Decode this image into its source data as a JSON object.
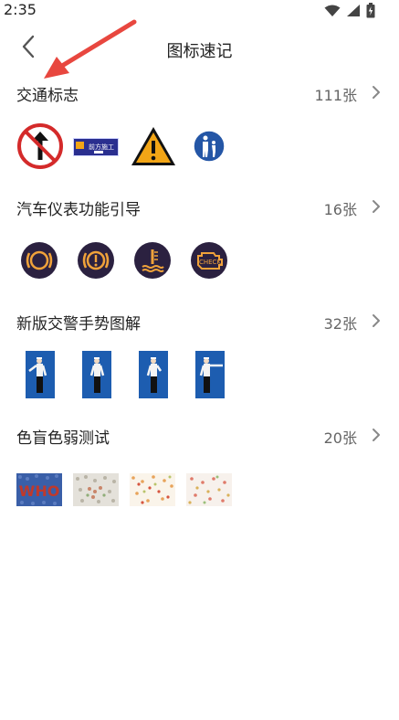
{
  "status_bar": {
    "time": "2:35",
    "icons": [
      "wifi-icon",
      "signal-icon",
      "battery-icon"
    ]
  },
  "header": {
    "title": "图标速记",
    "back_icon": "chevron-left-icon"
  },
  "sections": [
    {
      "title": "交通标志",
      "count": "111张",
      "thumbnails": [
        "no-straight-sign-icon",
        "road-work-ahead-sign-icon",
        "warning-triangle-sign-icon",
        "pedestrian-sign-icon"
      ]
    },
    {
      "title": "汽车仪表功能引导",
      "count": "16张",
      "thumbnails": [
        "brake-warning-icon",
        "brake-system-icon",
        "coolant-temperature-icon",
        "check-engine-icon"
      ]
    },
    {
      "title": "新版交警手势图解",
      "count": "32张",
      "thumbnails": [
        "traffic-police-gesture-1-image",
        "traffic-police-gesture-2-image",
        "traffic-police-gesture-3-image",
        "traffic-police-gesture-4-image"
      ]
    },
    {
      "title": "色盲色弱测试",
      "count": "20张",
      "thumbnails": [
        "color-test-who-image",
        "color-test-plate-2-image",
        "color-test-plate-3-image",
        "color-test-plate-4-image"
      ]
    }
  ],
  "thumbnail_text": {
    "road_work_label": "前方施工",
    "check_engine_label": "CHECK",
    "who_label": "WHO"
  },
  "colors": {
    "annotation_arrow": "#e8473f",
    "instrument_icon_bg": "#2b2140",
    "instrument_icon_fg": "#f0a23a",
    "police_bg": "#1d5db0",
    "sign_red": "#d42a2a",
    "sign_blue": "#2456a6",
    "sign_yellow": "#f2a516"
  }
}
